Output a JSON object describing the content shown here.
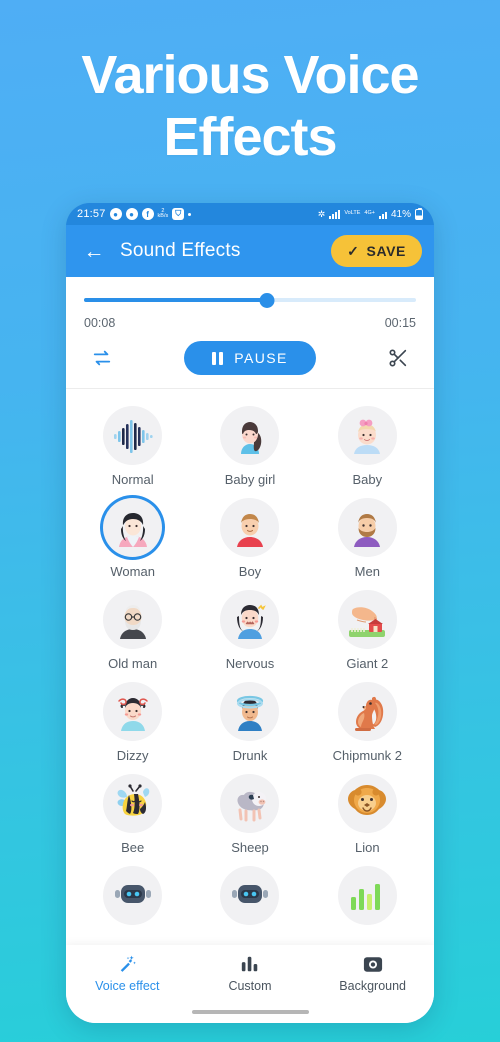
{
  "hero": {
    "line1": "Various Voice",
    "line2": "Effects"
  },
  "statusbar": {
    "time": "21:57",
    "icons": [
      "messenger-icon",
      "messenger-icon",
      "facebook-icon",
      "data-rate-icon",
      "vpn-shield-icon",
      "dot-icon"
    ],
    "data_rate": "2",
    "data_unit": "kB/s",
    "bluetooth": "bluetooth-icon",
    "volte_label": "VoLTE",
    "network_label": "4G+",
    "battery": "41%"
  },
  "appbar": {
    "back": "back-arrow-icon",
    "title": "Sound Effects",
    "save_check": "✓",
    "save_label": "SAVE"
  },
  "player": {
    "progress_percent": 55,
    "current_time": "00:08",
    "total_time": "00:15",
    "loop_icon": "repeat-icon",
    "pause_label": "PAUSE",
    "cut_icon": "scissors-icon"
  },
  "effects": {
    "selected": "Woman",
    "items": [
      {
        "label": "Normal",
        "icon": "waveform-icon"
      },
      {
        "label": "Baby girl",
        "icon": "baby-girl-icon"
      },
      {
        "label": "Baby",
        "icon": "baby-icon"
      },
      {
        "label": "Woman",
        "icon": "woman-icon"
      },
      {
        "label": "Boy",
        "icon": "boy-icon"
      },
      {
        "label": "Men",
        "icon": "men-icon"
      },
      {
        "label": "Old man",
        "icon": "old-man-icon"
      },
      {
        "label": "Nervous",
        "icon": "nervous-icon"
      },
      {
        "label": "Giant 2",
        "icon": "giant-foot-icon"
      },
      {
        "label": "Dizzy",
        "icon": "dizzy-icon"
      },
      {
        "label": "Drunk",
        "icon": "drunk-icon"
      },
      {
        "label": "Chipmunk 2",
        "icon": "squirrel-icon"
      },
      {
        "label": "Bee",
        "icon": "bee-icon"
      },
      {
        "label": "Sheep",
        "icon": "sheep-icon"
      },
      {
        "label": "Lion",
        "icon": "lion-icon"
      },
      {
        "label": "",
        "icon": "robot-icon"
      },
      {
        "label": "",
        "icon": "robot-icon"
      },
      {
        "label": "",
        "icon": "ai-icon"
      }
    ]
  },
  "bottomnav": {
    "items": [
      {
        "label": "Voice effect",
        "icon": "magic-wand-icon",
        "active": true
      },
      {
        "label": "Custom",
        "icon": "equalizer-icon",
        "active": false
      },
      {
        "label": "Background",
        "icon": "camera-icon",
        "active": false
      }
    ]
  },
  "colors": {
    "brand_blue": "#2a90ea",
    "save_yellow": "#F6C238",
    "appbar_blue": "#2f95ee",
    "bg_top": "#4FAEF5",
    "bg_bottom": "#27CFD8"
  }
}
